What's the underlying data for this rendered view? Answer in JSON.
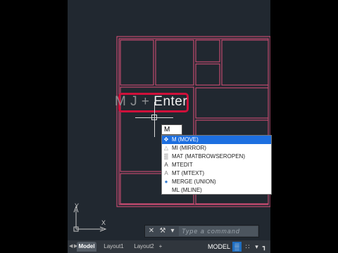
{
  "overlay": {
    "before_text": "M J + ",
    "highlight_text": "Enter"
  },
  "command_input": {
    "value": "M"
  },
  "autocomplete": {
    "items": [
      {
        "label": "M (MOVE)",
        "icon": "move-icon",
        "selected": true
      },
      {
        "label": "MI (MIRROR)",
        "icon": "mirror-icon",
        "selected": false
      },
      {
        "label": "MAT (MATBROWSEROPEN)",
        "icon": "material-browser-icon",
        "selected": false
      },
      {
        "label": "MTEDIT",
        "icon": "text-edit-icon",
        "selected": false
      },
      {
        "label": "MT (MTEXT)",
        "icon": "mtext-icon",
        "selected": false
      },
      {
        "label": "MERGE (UNION)",
        "icon": "union-icon",
        "selected": false
      },
      {
        "label": "ML (MLINE)",
        "icon": "mline-icon",
        "selected": false
      }
    ]
  },
  "ucs": {
    "x_label": "X",
    "y_label": "Y"
  },
  "command_line": {
    "placeholder": "Type a command"
  },
  "layout_tabs": {
    "tabs": [
      "Model",
      "Layout1",
      "Layout2"
    ],
    "add": "+"
  },
  "status_bar": {
    "model_label": "MODEL"
  },
  "colors": {
    "canvas": "#212830",
    "drawing_line": "#e0507a",
    "highlight_border": "#d0103a",
    "selection": "#1d6fe0"
  }
}
